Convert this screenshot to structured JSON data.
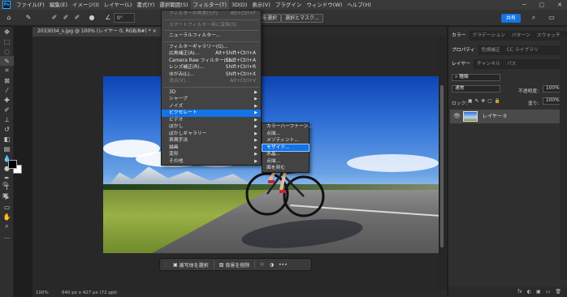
{
  "menubar": {
    "logo": "Ps",
    "items": [
      "ファイル(F)",
      "編集(E)",
      "イメージ(I)",
      "レイヤー(L)",
      "書式(Y)",
      "選択範囲(S)",
      "フィルター(T)",
      "3D(D)",
      "表示(V)",
      "プラグイン",
      "ウィンドウ(W)",
      "ヘルプ(H)"
    ],
    "window_controls": [
      "─",
      "▢",
      "✕"
    ]
  },
  "options_bar": {
    "angle": "0°",
    "select_subject_label": "被写体を選択",
    "select_and_mask_label": "選択とマスク...",
    "share_label": "共有"
  },
  "document": {
    "tab_title": "2033034_s.jpg @ 100% (レイヤー 0, RGB/8#) *  ×",
    "zoom": "100%",
    "dimensions": "640 px x 427 px (72 ppi)"
  },
  "context_bar": {
    "select_subject": "被写体を選択",
    "remove_background": "背景を削除",
    "more": "•••"
  },
  "filter_menu": {
    "items": [
      {
        "label": "フィルターの再実行(F)",
        "shortcut": "Alt+Ctrl+F",
        "disabled": true
      },
      {
        "sep": true
      },
      {
        "label": "スマートフィルター用に変換(S)",
        "disabled": true
      },
      {
        "sep": true
      },
      {
        "label": "ニューラルフィルター..."
      },
      {
        "sep": true
      },
      {
        "label": "フィルターギャラリー(G)..."
      },
      {
        "label": "広角補正(A)...",
        "shortcut": "Alt+Shift+Ctrl+A"
      },
      {
        "label": "Camera Raw フィルター(C)...",
        "shortcut": "Shift+Ctrl+A"
      },
      {
        "label": "レンズ補正(R)...",
        "shortcut": "Shift+Ctrl+R"
      },
      {
        "label": "ゆがみ(L)...",
        "shortcut": "Shift+Ctrl+X"
      },
      {
        "label": "消点(V)...",
        "shortcut": "Alt+Ctrl+V",
        "disabled": true
      },
      {
        "sep": true
      },
      {
        "label": "3D",
        "submenu": true
      },
      {
        "label": "シャープ",
        "submenu": true
      },
      {
        "label": "ノイズ",
        "submenu": true
      },
      {
        "label": "ピクセレート",
        "submenu": true,
        "highlight": true
      },
      {
        "label": "ビデオ",
        "submenu": true
      },
      {
        "label": "ぼかし",
        "submenu": true
      },
      {
        "label": "ぼかしギャラリー",
        "submenu": true
      },
      {
        "label": "表現手法",
        "submenu": true
      },
      {
        "label": "描画",
        "submenu": true
      },
      {
        "label": "変形",
        "submenu": true
      },
      {
        "label": "その他",
        "submenu": true
      }
    ]
  },
  "pixelate_submenu": {
    "items": [
      {
        "label": "カラーハーフトーン..."
      },
      {
        "label": "点描..."
      },
      {
        "label": "メゾティント..."
      },
      {
        "label": "モザイク...",
        "highlight": true
      },
      {
        "label": "水晶..."
      },
      {
        "label": "点描..."
      },
      {
        "label": "面を刻む"
      }
    ]
  },
  "right_panel": {
    "top_tabs": [
      "カラー",
      "グラデーション",
      "パターン",
      "スウォッチ"
    ],
    "mid_tabs": [
      "プロパティ",
      "色調補正",
      "CC ライブラリ"
    ],
    "layer_tabs": [
      "レイヤー",
      "チャンネル",
      "パス"
    ],
    "kind_label": "種類",
    "blend_mode": "通常",
    "opacity_label": "不透明度:",
    "opacity_value": "100%",
    "lock_label": "ロック:",
    "fill_label": "塗り:",
    "fill_value": "100%",
    "layer_name": "レイヤー 0",
    "footer_icons": [
      "fx",
      "◐",
      "▣",
      "▭",
      "🗑"
    ]
  },
  "colors": {
    "accent": "#1473e6",
    "menu_bg": "#434343"
  }
}
